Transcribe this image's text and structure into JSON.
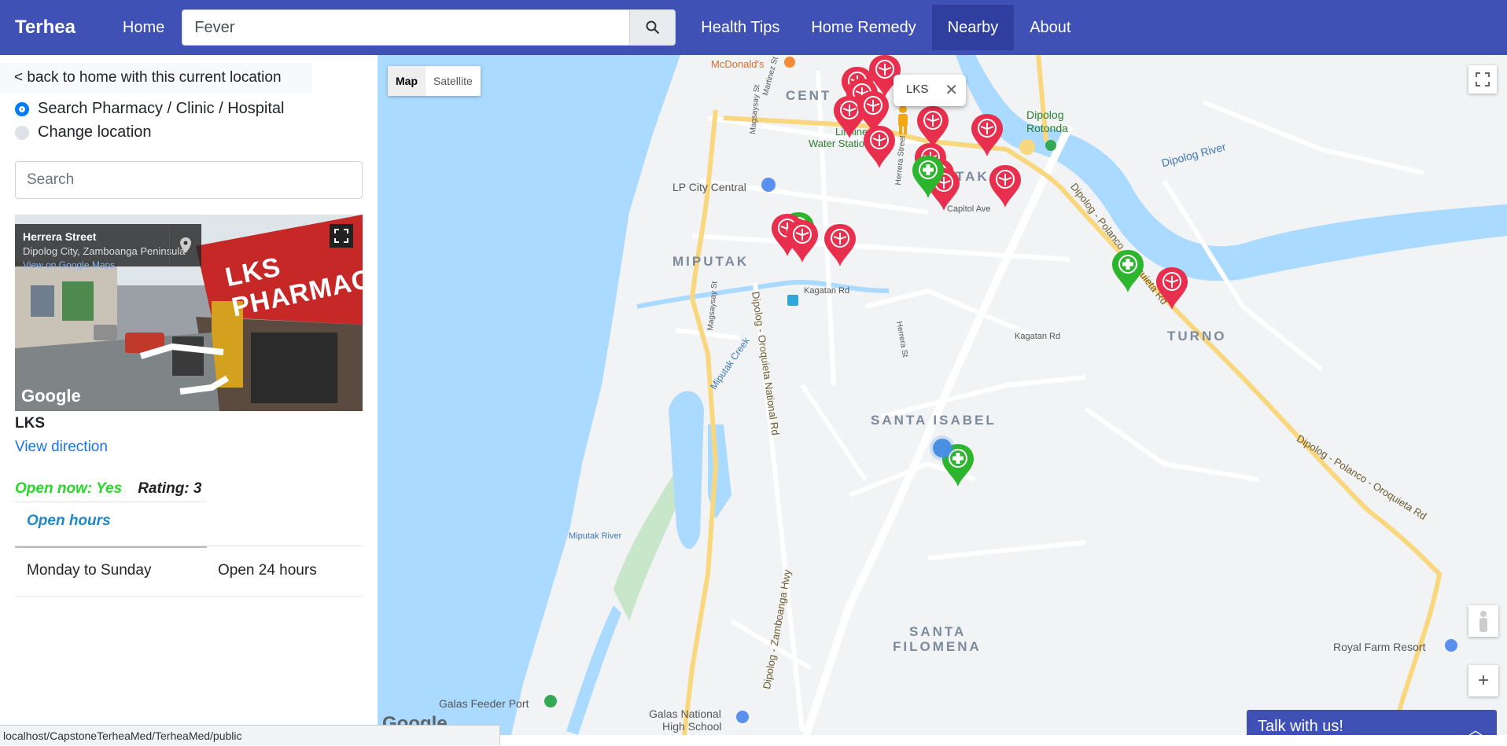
{
  "navbar": {
    "brand": "Terhea",
    "home": "Home",
    "search_value": "Fever",
    "health_tips": "Health Tips",
    "home_remedy": "Home Remedy",
    "nearby": "Nearby",
    "about": "About"
  },
  "sidebar": {
    "back_link": "< back to home with this current location",
    "option_search": "Search Pharmacy / Clinic / Hospital",
    "option_change": "Change location",
    "search_placeholder": "Search",
    "streetview": {
      "street": "Herrera Street",
      "city": "Dipolog City, Zamboanga Peninsula",
      "link": "View on Google Maps",
      "shop_sign": "LKS PHARMACY",
      "logo": "Google"
    },
    "place_name": "LKS",
    "view_direction": "View direction",
    "open_now": "Open now: Yes",
    "rating": "Rating: 3",
    "hours_title": "Open hours",
    "hours": [
      {
        "day": "Monday to Sunday",
        "time": "Open 24 hours"
      }
    ]
  },
  "map": {
    "type_map": "Map",
    "type_satellite": "Satellite",
    "infowindow": "LKS",
    "infowindow_close": "✕",
    "zoom_in": "+",
    "logo": "Google",
    "labels": {
      "mcdonalds": "McDonald's",
      "central": "CENT",
      "lifeline": "Lifeline",
      "water_station": "Water Station",
      "dipolog": "Dipolog",
      "rotonda": "Rotonda",
      "dipolog_river": "Dipolog River",
      "lp_city": "LP City Central",
      "miputak": "MIPUTAK",
      "estaka": "TAK",
      "capitol": "Capitol Ave",
      "kagatan1": "Kagatan Rd",
      "kagatan2": "Kagatan Rd",
      "turno": "TURNO",
      "santa_isabel": "SANTA ISABEL",
      "santa_filomena_1": "SANTA",
      "santa_filomena_2": "FILOMENA",
      "miputak_river": "Miputak River",
      "miputak_creek": "Miputak Creek",
      "royal_farm": "Royal Farm Resort",
      "galas_feeder": "Galas Feeder Port",
      "galas_school_1": "Galas National",
      "galas_school_2": "High School",
      "road_zamboanga": "Dipolog - Zamboanga Hwy",
      "road_oroquieta": "Dipolog - Oroquieta National Rd",
      "road_polanco1": "Dipolog - Polanco - Oroquieta Rd",
      "road_polanco2": "Dipolog - Polanco - Oroquieta Rd",
      "magsaysay1": "Magsaysay St",
      "magsaysay2": "Magsaysay St",
      "martinez": "Martinez St",
      "herrera": "Herrera Street",
      "herrera2": "Herrera St"
    }
  },
  "chat": {
    "label": "Talk with us!",
    "caret": "︿"
  },
  "statusbar": "localhost/CapstoneTerheaMed/TerheaMed/public",
  "colors": {
    "primary": "#3f51b5",
    "active_nav": "#303f9f",
    "pharmacy_pin": "#e8304e",
    "hospital_pin": "#2db52d",
    "water": "#aadaff"
  }
}
